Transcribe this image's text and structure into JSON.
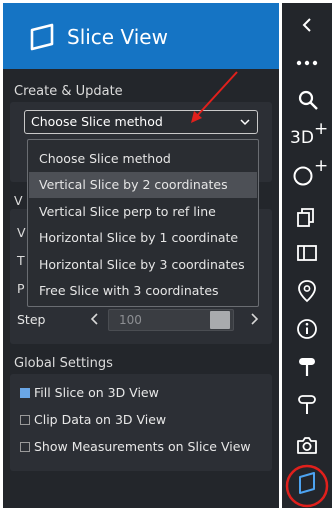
{
  "header": {
    "title": "Slice View"
  },
  "create_update": {
    "section_label": "Create & Update",
    "select_value": "Choose Slice method",
    "options": [
      "Choose Slice method",
      "Vertical Slice by 2 coordinates",
      "Vertical Slice perp to ref line",
      "Horizontal Slice by 1 coordinate",
      "Horizontal Slice by 3 coordinates",
      "Free Slice with 3 coordinates"
    ],
    "highlighted_index": 1
  },
  "hidden_stubs": [
    "V",
    "V",
    "T",
    "P"
  ],
  "step": {
    "label": "Step",
    "value": "100"
  },
  "global_settings": {
    "section_label": "Global Settings",
    "checkboxes": [
      {
        "label": "Fill Slice on 3D View",
        "checked": true
      },
      {
        "label": "Clip Data on 3D View",
        "checked": false
      },
      {
        "label": "Show Measurements on Slice View",
        "checked": false
      }
    ]
  },
  "toolbar": {
    "three_d_plus": "3D",
    "plus": "+",
    "active_tool": "slice-view"
  },
  "colors": {
    "panel": "#23262b",
    "header": "#1574c4",
    "highlight": "#4d5056",
    "annotation": "#e0201c"
  }
}
